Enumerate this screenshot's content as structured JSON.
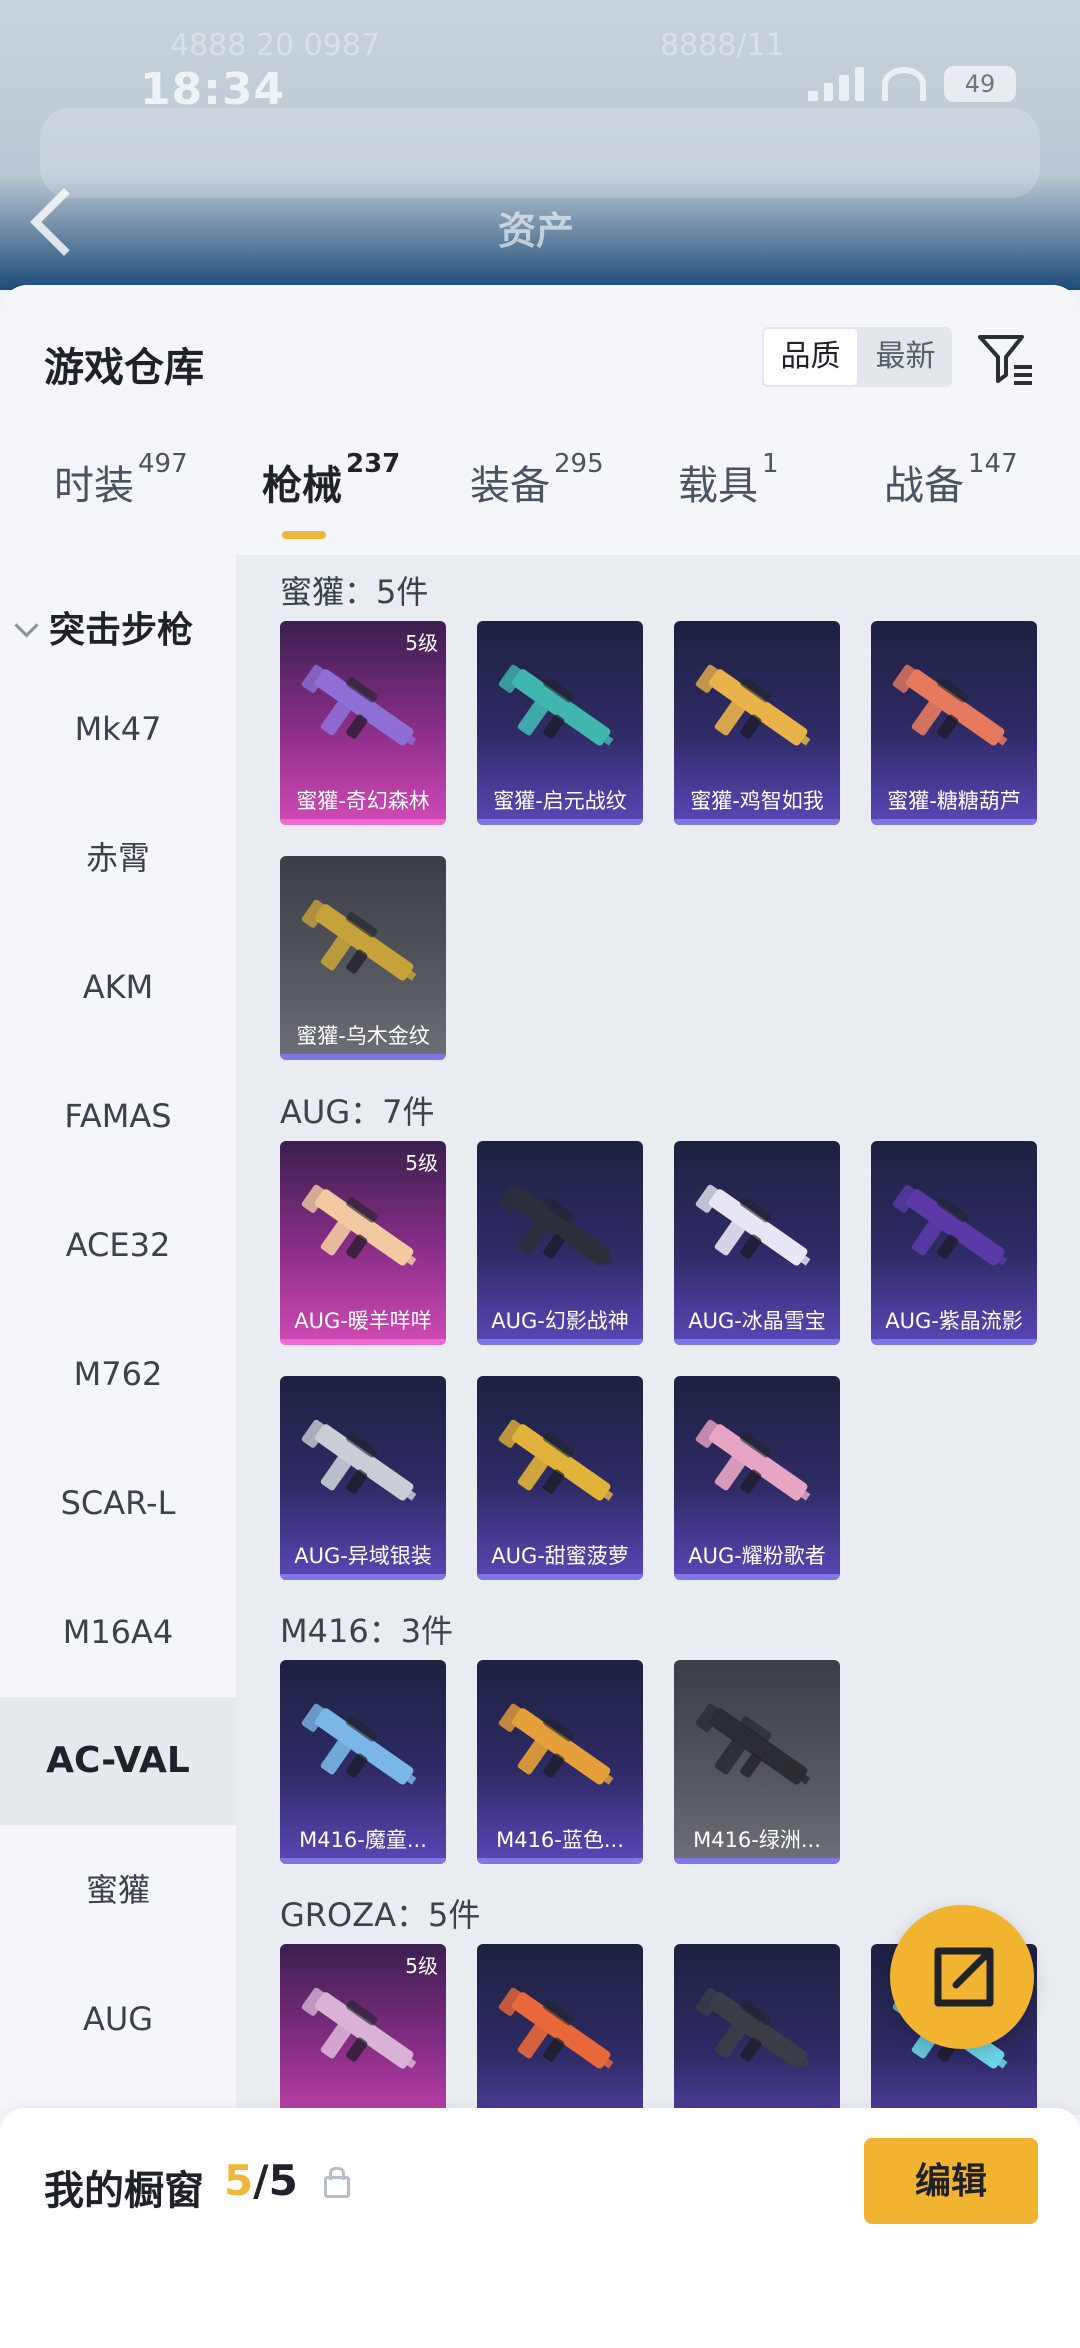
{
  "status_bar": {
    "time": "18:34",
    "battery": "49"
  },
  "background_header": {
    "blur_left": "4888 20 0987",
    "blur_right": "8888/11",
    "assets_title": "资产"
  },
  "sheet": {
    "title": "游戏仓库",
    "sort": {
      "options": [
        "品质",
        "最新"
      ],
      "selected": "品质"
    },
    "tabs": [
      {
        "label": "时装",
        "count": "497"
      },
      {
        "label": "枪械",
        "count": "237",
        "active": true
      },
      {
        "label": "装备",
        "count": "295"
      },
      {
        "label": "载具",
        "count": "1"
      },
      {
        "label": "战备",
        "count": "147"
      }
    ]
  },
  "sidebar": {
    "category": "突击步枪",
    "items": [
      "Mk47",
      "赤霄",
      "AKM",
      "FAMAS",
      "ACE32",
      "M762",
      "SCAR-L",
      "M16A4",
      "AC-VAL",
      "蜜獾",
      "AUG"
    ],
    "selected": "AC-VAL"
  },
  "groups": [
    {
      "title": "蜜獾：5件",
      "items": [
        {
          "name": "蜜獾-奇幻森林",
          "level": "5级",
          "style": "pink",
          "color": "#8e6fd6"
        },
        {
          "name": "蜜獾-启元战纹",
          "style": "purple",
          "color": "#3fb6b0"
        },
        {
          "name": "蜜獾-鸡智如我",
          "style": "purple",
          "color": "#e9b34a"
        },
        {
          "name": "蜜獾-糖糖葫芦",
          "style": "purple",
          "color": "#e67a5e"
        },
        {
          "name": "蜜獾-乌木金纹",
          "style": "gray",
          "color": "#c7a23a"
        }
      ]
    },
    {
      "title": "AUG：7件",
      "items": [
        {
          "name": "AUG-暖羊咩咩",
          "level": "5级",
          "style": "pink",
          "color": "#f2c9a0"
        },
        {
          "name": "AUG-幻影战神",
          "style": "purple",
          "color": "#2c2f3a"
        },
        {
          "name": "AUG-冰晶雪宝",
          "style": "purple",
          "color": "#e8e6f4"
        },
        {
          "name": "AUG-紫晶流影",
          "style": "purple",
          "color": "#5b3aa8"
        },
        {
          "name": "AUG-异域银装",
          "style": "purple",
          "color": "#c9ced6"
        },
        {
          "name": "AUG-甜蜜菠萝",
          "style": "purple",
          "color": "#e2b33a"
        },
        {
          "name": "AUG-耀粉歌者",
          "style": "purple",
          "color": "#e8a5c3"
        }
      ]
    },
    {
      "title": "M416：3件",
      "items": [
        {
          "name": "M416-魔童...",
          "style": "purple",
          "color": "#7ab6e6"
        },
        {
          "name": "M416-蓝色...",
          "style": "purple",
          "color": "#e6a03a"
        },
        {
          "name": "M416-绿洲...",
          "style": "gray",
          "color": "#2a2d33"
        }
      ]
    },
    {
      "title": "GROZA：5件",
      "items": [
        {
          "name": "",
          "level": "5级",
          "style": "pink",
          "color": "#d9b2d6"
        },
        {
          "name": "",
          "style": "purple",
          "color": "#e8683a"
        },
        {
          "name": "",
          "style": "purple",
          "color": "#3a3d46"
        },
        {
          "name": "",
          "style": "purple",
          "color": "#6ed6e6"
        }
      ]
    }
  ],
  "bottom_bar": {
    "label": "我的橱窗",
    "count_current": "5",
    "count_total": "/5",
    "edit_button": "编辑"
  }
}
